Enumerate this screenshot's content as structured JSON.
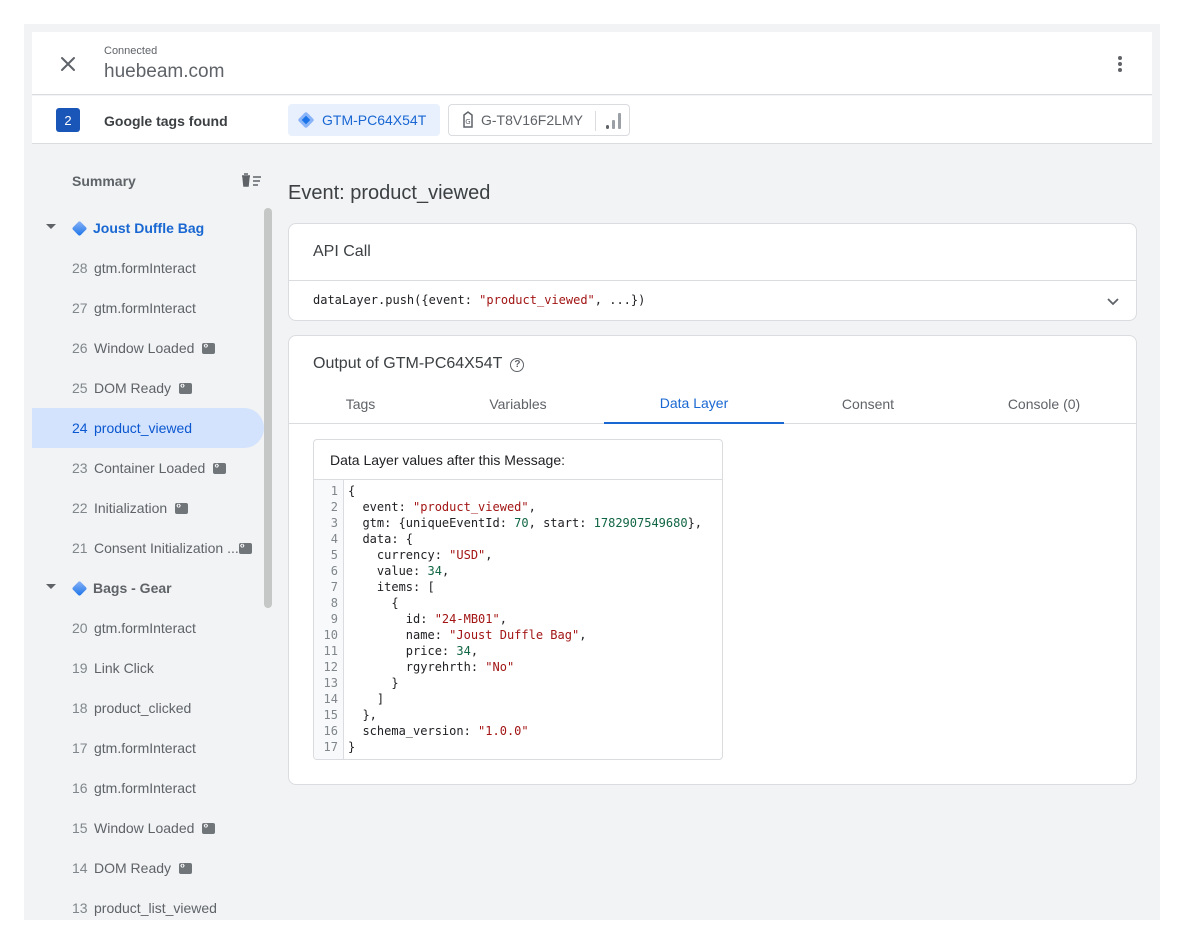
{
  "header": {
    "status": "Connected",
    "domain": "huebeam.com"
  },
  "tagbar": {
    "count": "2",
    "label": "Google tags found",
    "tags": [
      {
        "id": "GTM-PC64X54T"
      },
      {
        "id": "G-T8V16F2LMY"
      }
    ]
  },
  "sidebar": {
    "summary_label": "Summary",
    "pages": [
      {
        "title": "Joust Duffle Bag",
        "events": [
          {
            "num": "28",
            "name": "gtm.formInteract"
          },
          {
            "num": "27",
            "name": "gtm.formInteract"
          },
          {
            "num": "26",
            "name": "Window Loaded"
          },
          {
            "num": "25",
            "name": "DOM Ready"
          },
          {
            "num": "24",
            "name": "product_viewed"
          },
          {
            "num": "23",
            "name": "Container Loaded"
          },
          {
            "num": "22",
            "name": "Initialization"
          },
          {
            "num": "21",
            "name": "Consent Initialization ..."
          }
        ]
      },
      {
        "title": "Bags - Gear",
        "events": [
          {
            "num": "20",
            "name": "gtm.formInteract"
          },
          {
            "num": "19",
            "name": "Link Click"
          },
          {
            "num": "18",
            "name": "product_clicked"
          },
          {
            "num": "17",
            "name": "gtm.formInteract"
          },
          {
            "num": "16",
            "name": "gtm.formInteract"
          },
          {
            "num": "15",
            "name": "Window Loaded"
          },
          {
            "num": "14",
            "name": "DOM Ready"
          },
          {
            "num": "13",
            "name": "product_list_viewed"
          }
        ]
      }
    ]
  },
  "main": {
    "event_title": "Event: product_viewed",
    "api_card": {
      "title": "API Call",
      "code_prefix": "dataLayer.push({event: ",
      "code_event": "\"product_viewed\"",
      "code_suffix": ", ...})"
    },
    "output_card": {
      "title": "Output of GTM-PC64X54T",
      "help": "?",
      "tabs": [
        "Tags",
        "Variables",
        "Data Layer",
        "Consent",
        "Console (0)"
      ],
      "active_tab": "Data Layer",
      "datalayer_heading": "Data Layer values after this Message:",
      "code_lines": [
        {
          "n": "1",
          "k": "{",
          "v": "",
          "t": "",
          "e": ""
        },
        {
          "n": "2",
          "k": "  event: ",
          "v": "\"product_viewed\"",
          "t": "str",
          "e": ","
        },
        {
          "n": "3",
          "k": "  gtm: {uniqueEventId: ",
          "v": "70",
          "t": "num",
          "e": ", start: ",
          "v2": "1782907549680",
          "e2": "},"
        },
        {
          "n": "4",
          "k": "  data: {",
          "v": "",
          "t": "",
          "e": ""
        },
        {
          "n": "5",
          "k": "    currency: ",
          "v": "\"USD\"",
          "t": "str",
          "e": ","
        },
        {
          "n": "6",
          "k": "    value: ",
          "v": "34",
          "t": "num",
          "e": ","
        },
        {
          "n": "7",
          "k": "    items: [",
          "v": "",
          "t": "",
          "e": ""
        },
        {
          "n": "8",
          "k": "      {",
          "v": "",
          "t": "",
          "e": ""
        },
        {
          "n": "9",
          "k": "        id: ",
          "v": "\"24-MB01\"",
          "t": "str",
          "e": ","
        },
        {
          "n": "10",
          "k": "        name: ",
          "v": "\"Joust Duffle Bag\"",
          "t": "str",
          "e": ","
        },
        {
          "n": "11",
          "k": "        price: ",
          "v": "34",
          "t": "num",
          "e": ","
        },
        {
          "n": "12",
          "k": "        rgyrehrth: ",
          "v": "\"No\"",
          "t": "str",
          "e": ""
        },
        {
          "n": "13",
          "k": "      }",
          "v": "",
          "t": "",
          "e": ""
        },
        {
          "n": "14",
          "k": "    ]",
          "v": "",
          "t": "",
          "e": ""
        },
        {
          "n": "15",
          "k": "  },",
          "v": "",
          "t": "",
          "e": ""
        },
        {
          "n": "16",
          "k": "  schema_version: ",
          "v": "\"1.0.0\"",
          "t": "str",
          "e": ""
        },
        {
          "n": "17",
          "k": "}",
          "v": "",
          "t": "",
          "e": ""
        }
      ]
    }
  },
  "colors": {
    "accent": "#1967d2",
    "selected_bg": "#d3e3fd",
    "string": "#a31515",
    "number": "#116644"
  }
}
